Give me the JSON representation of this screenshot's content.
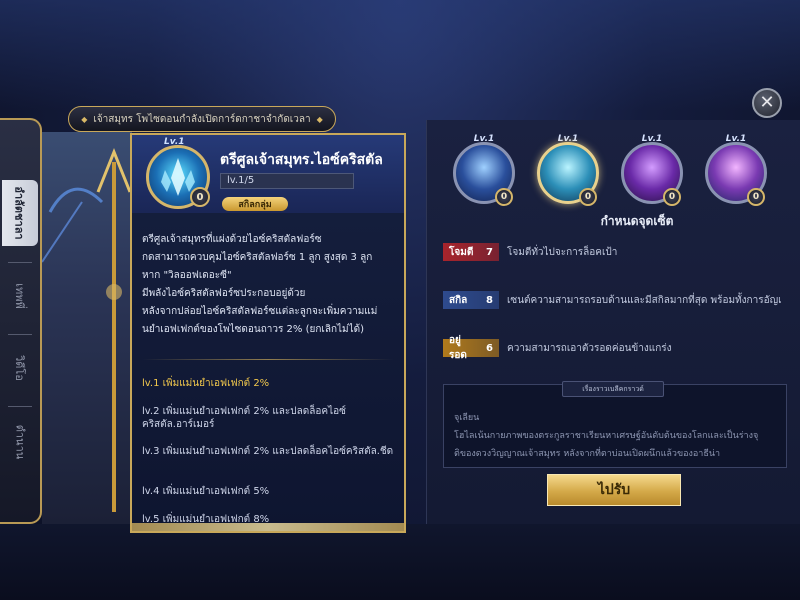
{
  "ribbon_title": "เจ้าสมุทร โพไซดอนกำลังเปิดการ์ดกาชาจำกัดเวลา",
  "close_icon": "close-icon",
  "left_tabs": [
    {
      "label": "อำลัตชาลา",
      "active": true
    },
    {
      "label": "เทพพี่",
      "active": false
    },
    {
      "label": "วิดีโอ",
      "active": false
    },
    {
      "label": "ตำนาน",
      "active": false
    }
  ],
  "popup": {
    "level_badge": "Lv.1",
    "rank": "0",
    "item_name": "ตรีศูลเจ้าสมุทร.ไอซ์คริสตัล",
    "level_text": "lv.1/5",
    "tag": "สกิลกลุ่ม",
    "description": [
      "ตรีศูลเจ้าสมุทรที่แผ่งด้วยไอซ์คริสตัลฟอร์ซ",
      "กดสามารถควบคุมไอซ์คริสตัลฟอร์ซ 1 ลูก สูงสุด 3 ลูก",
      "หาก \"วิลออฟเดอะซี\"",
      "มีพลังไอซ์คริสตัลฟอร์ซประกอบอยู่ด้วย",
      "หลังจากปล่อยไอซ์คริสตัลฟอร์ซแต่ละลูกจะเพิ่มความแม่",
      "นยำเอฟเฟกต์ของโพไซดอนถาวร 2% (ยกเลิกไม่ได้)"
    ],
    "levels": [
      "lv.1 เพิ่มแม่นยำเอฟเฟกต์ 2%",
      "lv.2 เพิ่มแม่นยำเอฟเฟกต์ 2% และปลดล็อคไอซ์คริสตัล.อาร์เมอร์",
      "lv.3 เพิ่มแม่นยำเอฟเฟกต์ 2% และปลดล็อคไอซ์คริสตัล.ชีด",
      "lv.4 เพิ่มแม่นยำเอฟเฟกต์ 5%",
      "lv.5 เพิ่มแม่นยำเอฟเฟกต์ 8%"
    ]
  },
  "orbs": [
    {
      "level": "Lv.1",
      "rank": "0",
      "colors": [
        "#9fd0ff",
        "#2a4f9c",
        "#111f4a"
      ]
    },
    {
      "level": "Lv.1",
      "rank": "0",
      "colors": [
        "#baf4ff",
        "#2c8fb8",
        "#103452"
      ]
    },
    {
      "level": "Lv.1",
      "rank": "0",
      "colors": [
        "#d39cff",
        "#6a2aa8",
        "#24103f"
      ]
    },
    {
      "level": "Lv.1",
      "rank": "0",
      "colors": [
        "#f2b5ff",
        "#7a3ab2",
        "#1c2460"
      ]
    }
  ],
  "section_title": "กำหนดจุดเซ็ต",
  "stats": [
    {
      "label": "โจมตี",
      "value": "7",
      "text": "โจมตีทั่วไปจะการล็อคเป้า",
      "color": "#a8242c"
    },
    {
      "label": "สกิล",
      "value": "8",
      "text": "เซนต์ความสามารถรอบด้านและมีสกิลมากที่สุด พร้อมทั้งการอัญเ",
      "color": "#2e4b8e"
    },
    {
      "label": "อยู่รอด",
      "value": "6",
      "text": "ความสามารถเอาตัวรอดค่อนข้างแกร่ง",
      "color": "#b07a1c"
    }
  ],
  "story": {
    "title": "เรื่องราวเบลีคกราวด์",
    "lines": [
      "จุเลียน",
      "โฮไลเน้นกายภาพของตระกูลราชาเรียนหาเศรษฐ์อันดับต้นของโลกและเป็นร่างจุ",
      "ติของดวงวิญญาณเจ้าสมุทร หลังจากที่ตาบ่อนเปิดผนึกแล้วของอาธีน่า"
    ]
  },
  "confirm_label": "ไปรับ"
}
